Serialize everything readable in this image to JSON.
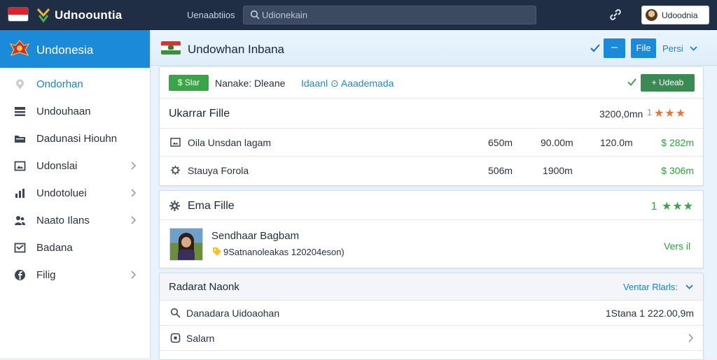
{
  "topbar": {
    "app_title": "Udnoountia",
    "top_link": "Uenaabtiios",
    "search_placeholder": "Udionekain",
    "user_name": "Udoodnia",
    "colors": {
      "bar": "#1f2d45",
      "accent": "#1b8ad9"
    }
  },
  "sidebar": {
    "title": "Undonesia",
    "items": [
      {
        "label": "Ondorhan",
        "icon": "location-pin-icon",
        "has_chevron": false
      },
      {
        "label": "Undouhaan",
        "icon": "table-icon",
        "has_chevron": false
      },
      {
        "label": "Dadunasi Hiouhn",
        "icon": "folder-icon",
        "has_chevron": false
      },
      {
        "label": "Udonslai",
        "icon": "image-icon",
        "has_chevron": true
      },
      {
        "label": "Undotoluei",
        "icon": "bar-chart-icon",
        "has_chevron": true
      },
      {
        "label": "Naato Ilans",
        "icon": "users-icon",
        "has_chevron": true
      },
      {
        "label": "Badana",
        "icon": "inbox-icon",
        "has_chevron": false
      },
      {
        "label": "Filig",
        "icon": "facebook-icon",
        "has_chevron": true
      }
    ]
  },
  "header": {
    "title": "Undowhan Inbana",
    "btn_dash": "–",
    "btn_file": "File",
    "dropdown": "Persi"
  },
  "panel1": {
    "badge": "$ Slar",
    "meta_prefix": "Nanake:  Dleane",
    "meta_link": "Idaanl ⊙  Aaademada",
    "action_button": "+ Udeab",
    "title": "Ukarrar Fille",
    "total": "3200,0mn",
    "rating_prefix": "1",
    "rating_stars": "★★★",
    "rows": [
      {
        "icon": "image-icon",
        "name": "Oila Unsdan lagam",
        "c1": "650m",
        "c2": "90.00m",
        "c3": "120.0m",
        "price": "$ 282m"
      },
      {
        "icon": "settings-cog-icon",
        "name": "Stauya Forola",
        "c1": "506m",
        "c2": "1900m",
        "c3": "",
        "price": "$ 306m"
      }
    ]
  },
  "panel2": {
    "title": "Ema Fille",
    "rating": "1 ★★★",
    "name": "Sendhaar Bagbam",
    "meta": "9Satnanoleakas 120204eson)",
    "link": "Vers il"
  },
  "panel3": {
    "title": "Radarat Naonk",
    "dropdown": "Ventar Rlarls:",
    "rows": [
      {
        "icon": "search-icon",
        "name": "Danadara Uidoaohan",
        "right": "1Stana  1 222.00,9m"
      },
      {
        "icon": "square-icon",
        "name": "Salarn",
        "right": ""
      }
    ]
  }
}
